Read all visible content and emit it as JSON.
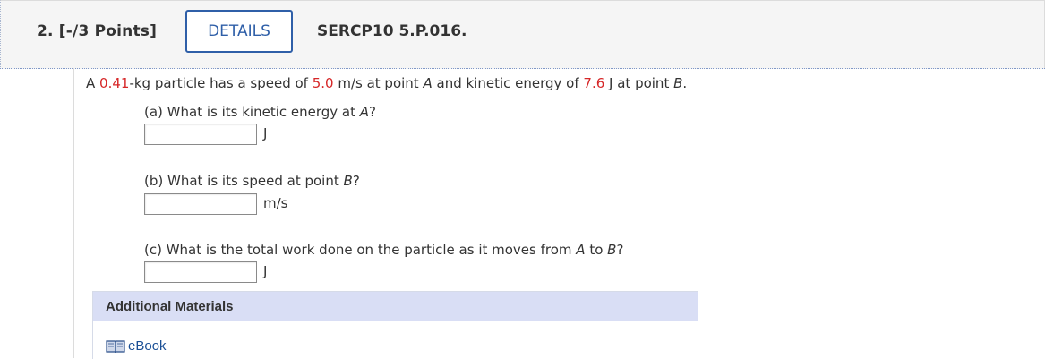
{
  "header": {
    "question_number": "2. [-/3 Points]",
    "details_label": "DETAILS",
    "problem_id": "SERCP10 5.P.016."
  },
  "question": {
    "stem": {
      "t1": "A ",
      "mass": "0.41",
      "t2": "-kg particle has a speed of ",
      "speed": "5.0",
      "t3": " m/s at point ",
      "point_a": "A",
      "t4": " and kinetic energy of ",
      "energy": "7.6",
      "t5": " J at point ",
      "point_b": "B",
      "t6": "."
    },
    "parts": [
      {
        "label_text": "(a) What is its kinetic energy at ",
        "label_var": "A",
        "label_end": "?",
        "value": "",
        "unit": "J"
      },
      {
        "label_text": "(b) What is its speed at point ",
        "label_var": "B",
        "label_end": "?",
        "value": "",
        "unit": "m/s"
      },
      {
        "label_text": "(c) What is the total work done on the particle as it moves from ",
        "label_var": "A",
        "label_mid": " to ",
        "label_var2": "B",
        "label_end": "?",
        "value": "",
        "unit": "J"
      }
    ]
  },
  "additional_materials": {
    "title": "Additional Materials",
    "ebook_label": "eBook",
    "ebook_icon": "book-icon"
  },
  "colors": {
    "accent": "#2f5fa8",
    "given_value": "#d62728",
    "materials_header_bg": "#d9def5",
    "link": "#1a4f96"
  }
}
